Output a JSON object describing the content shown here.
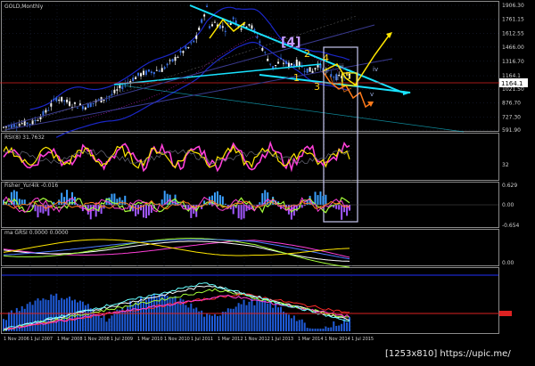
{
  "window": {
    "title": "GOLD,Monthly"
  },
  "colors": {
    "bg": "#000000",
    "grid": "#1f2a44",
    "bull": "#f2f2f2",
    "bear": "#3a6fe0",
    "trend": "#19e3ff",
    "wave_label": "#ffd51a",
    "wave_box": "#c59bff",
    "hline": "#dd2222",
    "yellow_line": "#ffe600",
    "orange_line": "#ff7a1a",
    "magenta": "#ff3fd8",
    "lime": "#a6ff3a",
    "white": "#ffffff",
    "violet": "#a259ff",
    "cyan_hist": "#3aa0ff",
    "blue_line": "#1b27c9"
  },
  "price_panel": {
    "scale_labels": [
      "1906.30",
      "1761.15",
      "1612.55",
      "1466.00",
      "1316.70",
      "1164.1",
      "1021.50",
      "876.70",
      "727.30",
      "591.90"
    ],
    "current_price": "1164.1"
  },
  "rsi_panel": {
    "label": "RSI(8) 31.7632",
    "scale_labels": [
      "32"
    ]
  },
  "fisher_panel": {
    "label": "Fisher_Yur4ik -0.016",
    "scale_labels": [
      "0.629",
      "0.00",
      "-0.654"
    ]
  },
  "indicator3_panel": {
    "label": "ma GRSI 0.0000 0.0000",
    "scale_labels": [
      "0.00"
    ]
  },
  "indicator4_panel": {
    "label": "",
    "scale_labels": []
  },
  "wave_labels": {
    "box": "[4]",
    "w1": "1",
    "w2": "2",
    "w3": "3",
    "w4": "4",
    "w5": "5",
    "wi": "i",
    "wii": "ii",
    "wiii": "iii",
    "wiv": "iv",
    "wv": "v"
  },
  "time_axis": [
    "1 Nov 2006",
    "1 Jul 2007",
    "1 Mar 2008",
    "1 Nov 2008",
    "1 Jul 2009",
    "1 Mar 2010",
    "1 Nov 2010",
    "1 Jul 2011",
    "1 Mar 2012",
    "1 Nov 2012",
    "1 Jul 2013",
    "1 Mar 2014",
    "1 Nov 2014",
    "1 Jul 2015"
  ],
  "watermark": "[1253x810] https://upic.me/",
  "chart_data": {
    "type": "candlestick",
    "title": "GOLD,Monthly",
    "x_axis": "time (monthly)",
    "ylim": [
      591.9,
      1906.3
    ],
    "y_scale_labels": [
      1906.3,
      1761.15,
      1612.55,
      1466.0,
      1316.7,
      1164.1,
      1021.5,
      876.7,
      727.3,
      591.9
    ],
    "price_path": [
      [
        0,
        620
      ],
      [
        6,
        660
      ],
      [
        11,
        670
      ],
      [
        16,
        780
      ],
      [
        20,
        930
      ],
      [
        23,
        900
      ],
      [
        26,
        860
      ],
      [
        31,
        840
      ],
      [
        36,
        900
      ],
      [
        41,
        960
      ],
      [
        47,
        1100
      ],
      [
        52,
        1180
      ],
      [
        56,
        1210
      ],
      [
        60,
        1230
      ],
      [
        64,
        1320
      ],
      [
        67,
        1400
      ],
      [
        70,
        1460
      ],
      [
        73,
        1560
      ],
      [
        76,
        1820
      ],
      [
        77,
        1880
      ],
      [
        78,
        1690
      ],
      [
        80,
        1720
      ],
      [
        84,
        1660
      ],
      [
        87,
        1770
      ],
      [
        90,
        1680
      ],
      [
        93,
        1720
      ],
      [
        96,
        1580
      ],
      [
        99,
        1395
      ],
      [
        102,
        1250
      ],
      [
        105,
        1320
      ],
      [
        108,
        1280
      ],
      [
        111,
        1300
      ],
      [
        114,
        1240
      ],
      [
        117,
        1210
      ],
      [
        119,
        1285
      ],
      [
        121,
        1230
      ],
      [
        124,
        1170
      ],
      [
        127,
        1140
      ],
      [
        130,
        1165
      ]
    ],
    "current_price": 1164.1
  }
}
